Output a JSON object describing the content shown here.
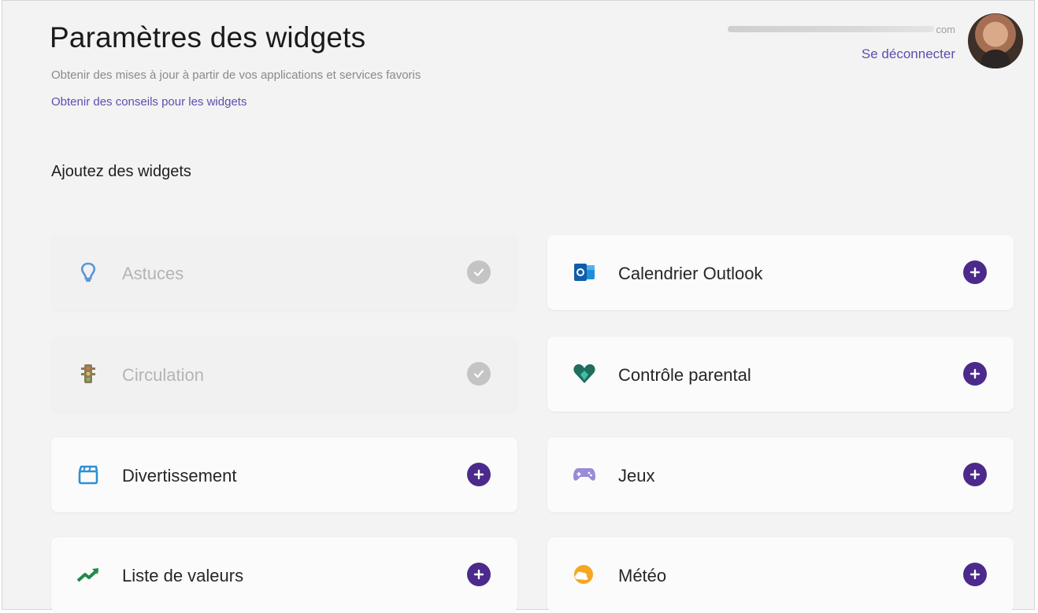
{
  "header": {
    "title": "Paramètres des widgets",
    "subtitle": "Obtenir des mises à jour à partir de vos applications et services favoris",
    "tips_link": "Obtenir des conseils pour les widgets"
  },
  "account": {
    "email_visible_suffix": "com",
    "signout_label": "Se déconnecter"
  },
  "section": {
    "title": "Ajoutez des widgets"
  },
  "colors": {
    "accent": "#4b2a8c",
    "link": "#5b4fb0",
    "added": "#c4c4c4"
  },
  "widgets": [
    {
      "label": "Astuces",
      "icon": "lightbulb-icon",
      "state": "added"
    },
    {
      "label": "Calendrier Outlook",
      "icon": "outlook-calendar-icon",
      "state": "available"
    },
    {
      "label": "Circulation",
      "icon": "traffic-light-icon",
      "state": "added"
    },
    {
      "label": "Contrôle parental",
      "icon": "family-heart-icon",
      "state": "available"
    },
    {
      "label": "Divertissement",
      "icon": "clapperboard-icon",
      "state": "available"
    },
    {
      "label": "Jeux",
      "icon": "gamepad-icon",
      "state": "available"
    },
    {
      "label": "Liste de valeurs",
      "icon": "stock-chart-icon",
      "state": "available"
    },
    {
      "label": "Météo",
      "icon": "weather-icon",
      "state": "available"
    }
  ]
}
